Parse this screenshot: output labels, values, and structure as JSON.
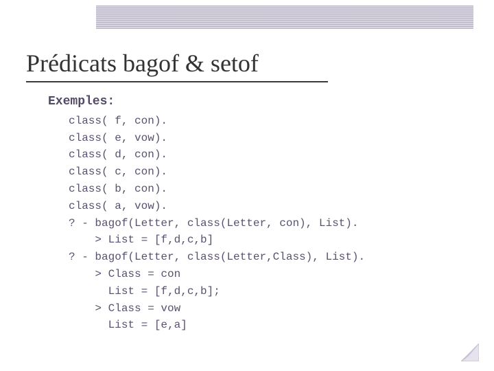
{
  "title": "Prédicats bagof & setof",
  "heading": "Exemples:",
  "lines": [
    "class( f, con).",
    "class( e, vow).",
    "class( d, con).",
    "class( c, con).",
    "class( b, con).",
    "class( a, vow).",
    "? - bagof(Letter, class(Letter, con), List).",
    "    > List = [f,d,c,b]",
    "? - bagof(Letter, class(Letter,Class), List).",
    "    > Class = con",
    "      List = [f,d,c,b];",
    "    > Class = vow",
    "      List = [e,a]"
  ]
}
